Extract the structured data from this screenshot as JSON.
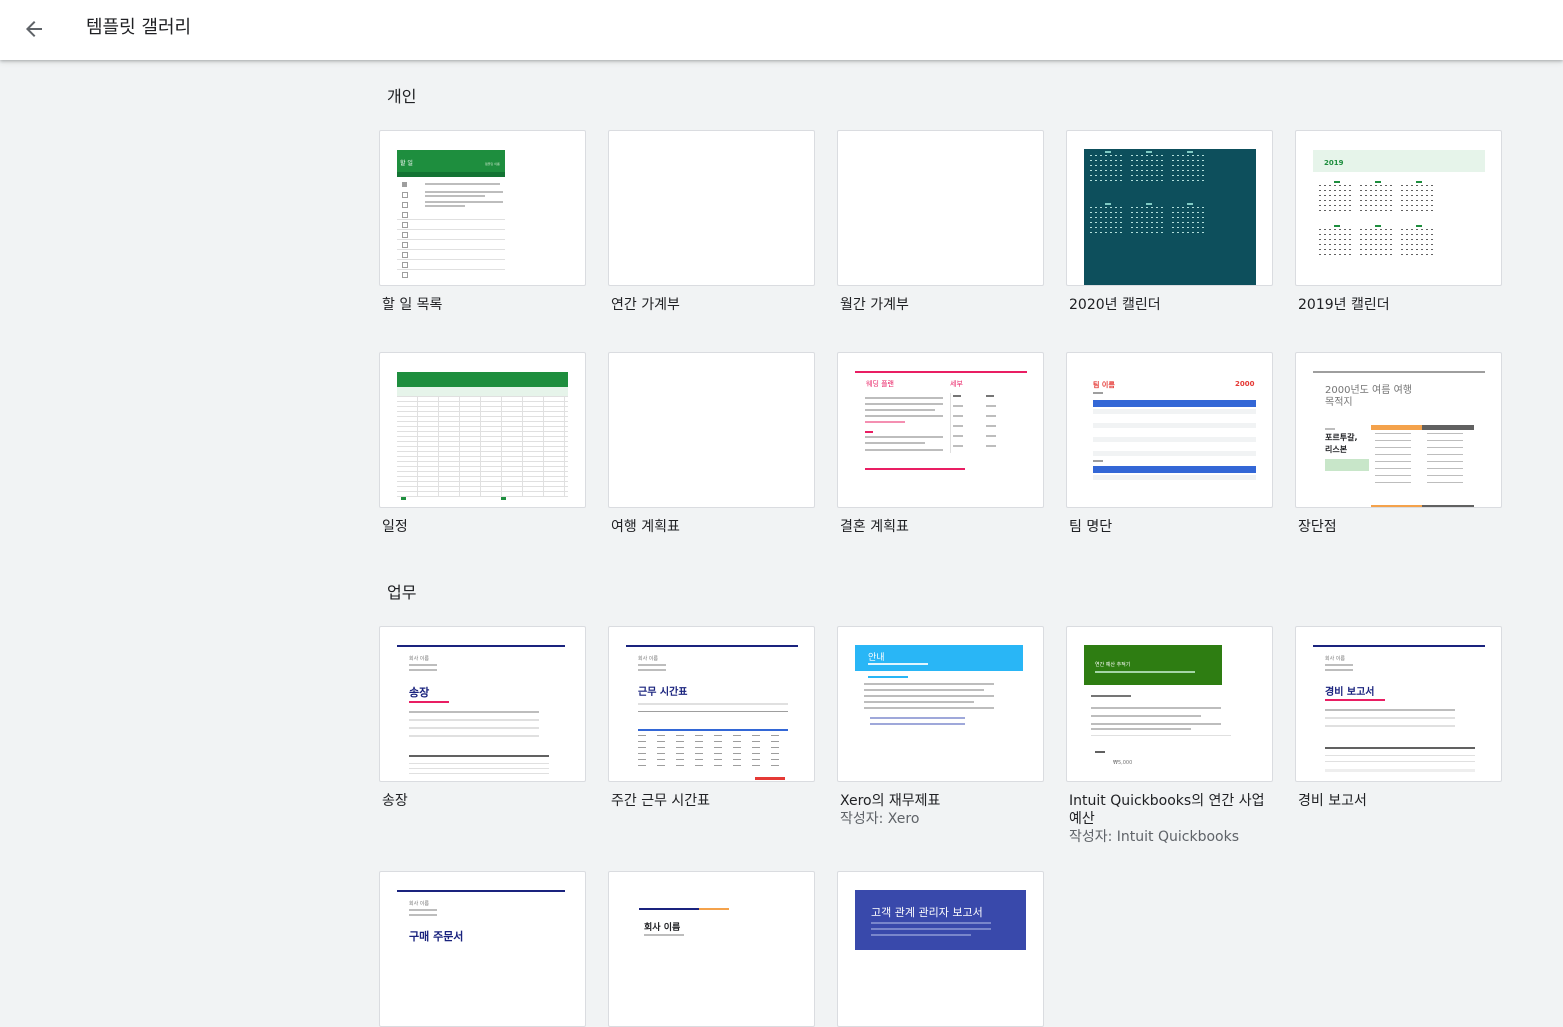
{
  "header": {
    "title": "템플릿 갤러리"
  },
  "sections": {
    "personal": {
      "title": "개인",
      "tiles": [
        {
          "name": "할 일 목록",
          "preview_title": "할 일",
          "preview_sub": "템플릿 이름",
          "preview_cols": [
            "완료",
            "할 일"
          ]
        },
        {
          "name": "연간 가계부"
        },
        {
          "name": "월간 가계부"
        },
        {
          "name": "2020년 캘린더"
        },
        {
          "name": "2019년 캘린더",
          "preview_year": "2019"
        },
        {
          "name": "일정"
        },
        {
          "name": "여행 계획표"
        },
        {
          "name": "결혼 계획표",
          "preview_title": "웨딩 플랜",
          "preview_sub": "세부"
        },
        {
          "name": "팀 명단",
          "preview_title": "팀 이름",
          "preview_year": "2000"
        },
        {
          "name": "장단점",
          "preview_title": "2000년도 여름 여행 목적지",
          "preview_sub": "포르투갈, 리스본"
        }
      ]
    },
    "work": {
      "title": "업무",
      "tiles": [
        {
          "name": "송장",
          "preview_company": "회사 이름",
          "preview_title": "송장"
        },
        {
          "name": "주간 근무 시간표",
          "preview_company": "회사 이름",
          "preview_title": "근무 시간표"
        },
        {
          "name": "Xero의 재무제표",
          "author": "작성자: Xero",
          "preview_title": "안내"
        },
        {
          "name": "Intuit Quickbooks의 연간 사업 예산",
          "author": "작성자: Intuit Quickbooks",
          "preview_title": "연간 예산 추적기",
          "preview_amount": "₩5,000"
        },
        {
          "name": "경비 보고서",
          "preview_company": "회사 이름",
          "preview_title": "경비 보고서"
        },
        {
          "name": "",
          "preview_company": "회사 이름",
          "preview_title": "구매 주문서"
        },
        {
          "name": "",
          "preview_title": "회사 이름"
        },
        {
          "name": "",
          "preview_title": "고객 관계 관리자 보고서"
        }
      ]
    }
  },
  "colors": {
    "green": "#1e8e3e",
    "teal": "#0d4f5c",
    "navy": "#1a237e",
    "pink": "#e91e63",
    "blue": "#3367d6",
    "sky": "#29b6f6",
    "forest": "#2e7d12",
    "orange": "#f4a24b",
    "red": "#e53935"
  }
}
